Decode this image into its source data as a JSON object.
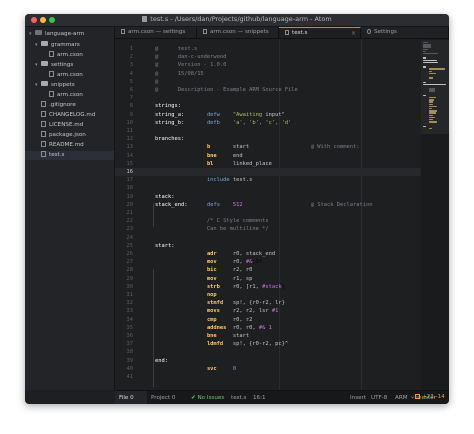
{
  "window": {
    "title": "test.s - /Users/dan/Projects/github/language-arm - Atom"
  },
  "tree": {
    "root": "language-arm",
    "items": [
      {
        "label": "grammars",
        "kind": "folder"
      },
      {
        "label": "arm.cson",
        "kind": "file"
      },
      {
        "label": "settings",
        "kind": "folder"
      },
      {
        "label": "arm.cson",
        "kind": "file"
      },
      {
        "label": "snippets",
        "kind": "folder"
      },
      {
        "label": "arm.cson",
        "kind": "file"
      },
      {
        "label": ".gitignore",
        "kind": "file"
      },
      {
        "label": "CHANGELOG.md",
        "kind": "file"
      },
      {
        "label": "LICENSE.md",
        "kind": "file"
      },
      {
        "label": "package.json",
        "kind": "file"
      },
      {
        "label": "README.md",
        "kind": "file"
      },
      {
        "label": "test.s",
        "kind": "file"
      }
    ]
  },
  "tabs": [
    {
      "label": "arm.cson — settings"
    },
    {
      "label": "arm.cson — snippets"
    },
    {
      "label": "test.s"
    },
    {
      "label": "Settings"
    }
  ],
  "editor": {
    "current_line": 16,
    "lines": [
      {
        "n": "1",
        "t": "@      test.s"
      },
      {
        "n": "2",
        "t": "@      dan-c-underwood"
      },
      {
        "n": "3",
        "t": "@      Version - 1.0.0"
      },
      {
        "n": "4",
        "t": "@      15/08/15"
      },
      {
        "n": "5",
        "t": "@"
      },
      {
        "n": "6",
        "t": "@      Description - Example ARM Source File"
      },
      {
        "n": "7",
        "t": ""
      },
      {
        "n": "8",
        "t": "strings:"
      },
      {
        "n": "9",
        "t": "string_a:       defw    \"Awaiting input\""
      },
      {
        "n": "10",
        "t": "string_b:       defb    'a', 'b', 'c', 'd'"
      },
      {
        "n": "11",
        "t": ""
      },
      {
        "n": "12",
        "t": "branches:"
      },
      {
        "n": "13",
        "t": "                b       start                   @ With comment:"
      },
      {
        "n": "14",
        "t": "                bne     end"
      },
      {
        "n": "15",
        "t": "                bl      linked_place"
      },
      {
        "n": "16",
        "t": ""
      },
      {
        "n": "17",
        "t": "                include test.s"
      },
      {
        "n": "18",
        "t": ""
      },
      {
        "n": "19",
        "t": "stack:"
      },
      {
        "n": "20",
        "t": "stack_end:      defs    512                     @ Stack Declaration"
      },
      {
        "n": "21",
        "t": ""
      },
      {
        "n": "22",
        "t": "                /* C Style comments"
      },
      {
        "n": "23",
        "t": "                Can be multiline */"
      },
      {
        "n": "24",
        "t": ""
      },
      {
        "n": "25",
        "t": "start:"
      },
      {
        "n": "26",
        "t": "                adr     r0, stack_end"
      },
      {
        "n": "27",
        "t": "                mov     r0, #&3f"
      },
      {
        "n": "28",
        "t": "                bic     r2, r0"
      },
      {
        "n": "29",
        "t": "                mov     r1, sp"
      },
      {
        "n": "30",
        "t": "                strb    r0, [r1, #stack]"
      },
      {
        "n": "31",
        "t": "                nop"
      },
      {
        "n": "32",
        "t": "                stmfd   sp!, {r0-r2, lr}"
      },
      {
        "n": "33",
        "t": "                movs    r2, r2, lsr #1"
      },
      {
        "n": "34",
        "t": "                cmp     r0, r2"
      },
      {
        "n": "35",
        "t": "                addnes  r0, r0, #&1"
      },
      {
        "n": "36",
        "t": "                bne     start"
      },
      {
        "n": "37",
        "t": "                ldmfd   sp!, {r0-r2, pc}^"
      },
      {
        "n": "38",
        "t": ""
      },
      {
        "n": "39",
        "t": "end:"
      },
      {
        "n": "40",
        "t": "                svc     0"
      },
      {
        "n": "41",
        "t": ""
      }
    ]
  },
  "status": {
    "file_tab": "File 0",
    "project": "Project 0",
    "issues": "No Issues",
    "file_name": "test.s",
    "cursor": "16:1",
    "mode": "Insert",
    "encoding": "UTF-8",
    "grammar": "ARM",
    "branch": "master",
    "diff": "+23,-14"
  },
  "colors": {
    "background": "#1d1f21",
    "label": "#ffffff",
    "opcode": "#ffc86b",
    "directive": "#7aa6da",
    "string": "#b5bd68",
    "immediate": "#c678dd",
    "comment": "#7d8085",
    "accent": "#e8a03a"
  }
}
